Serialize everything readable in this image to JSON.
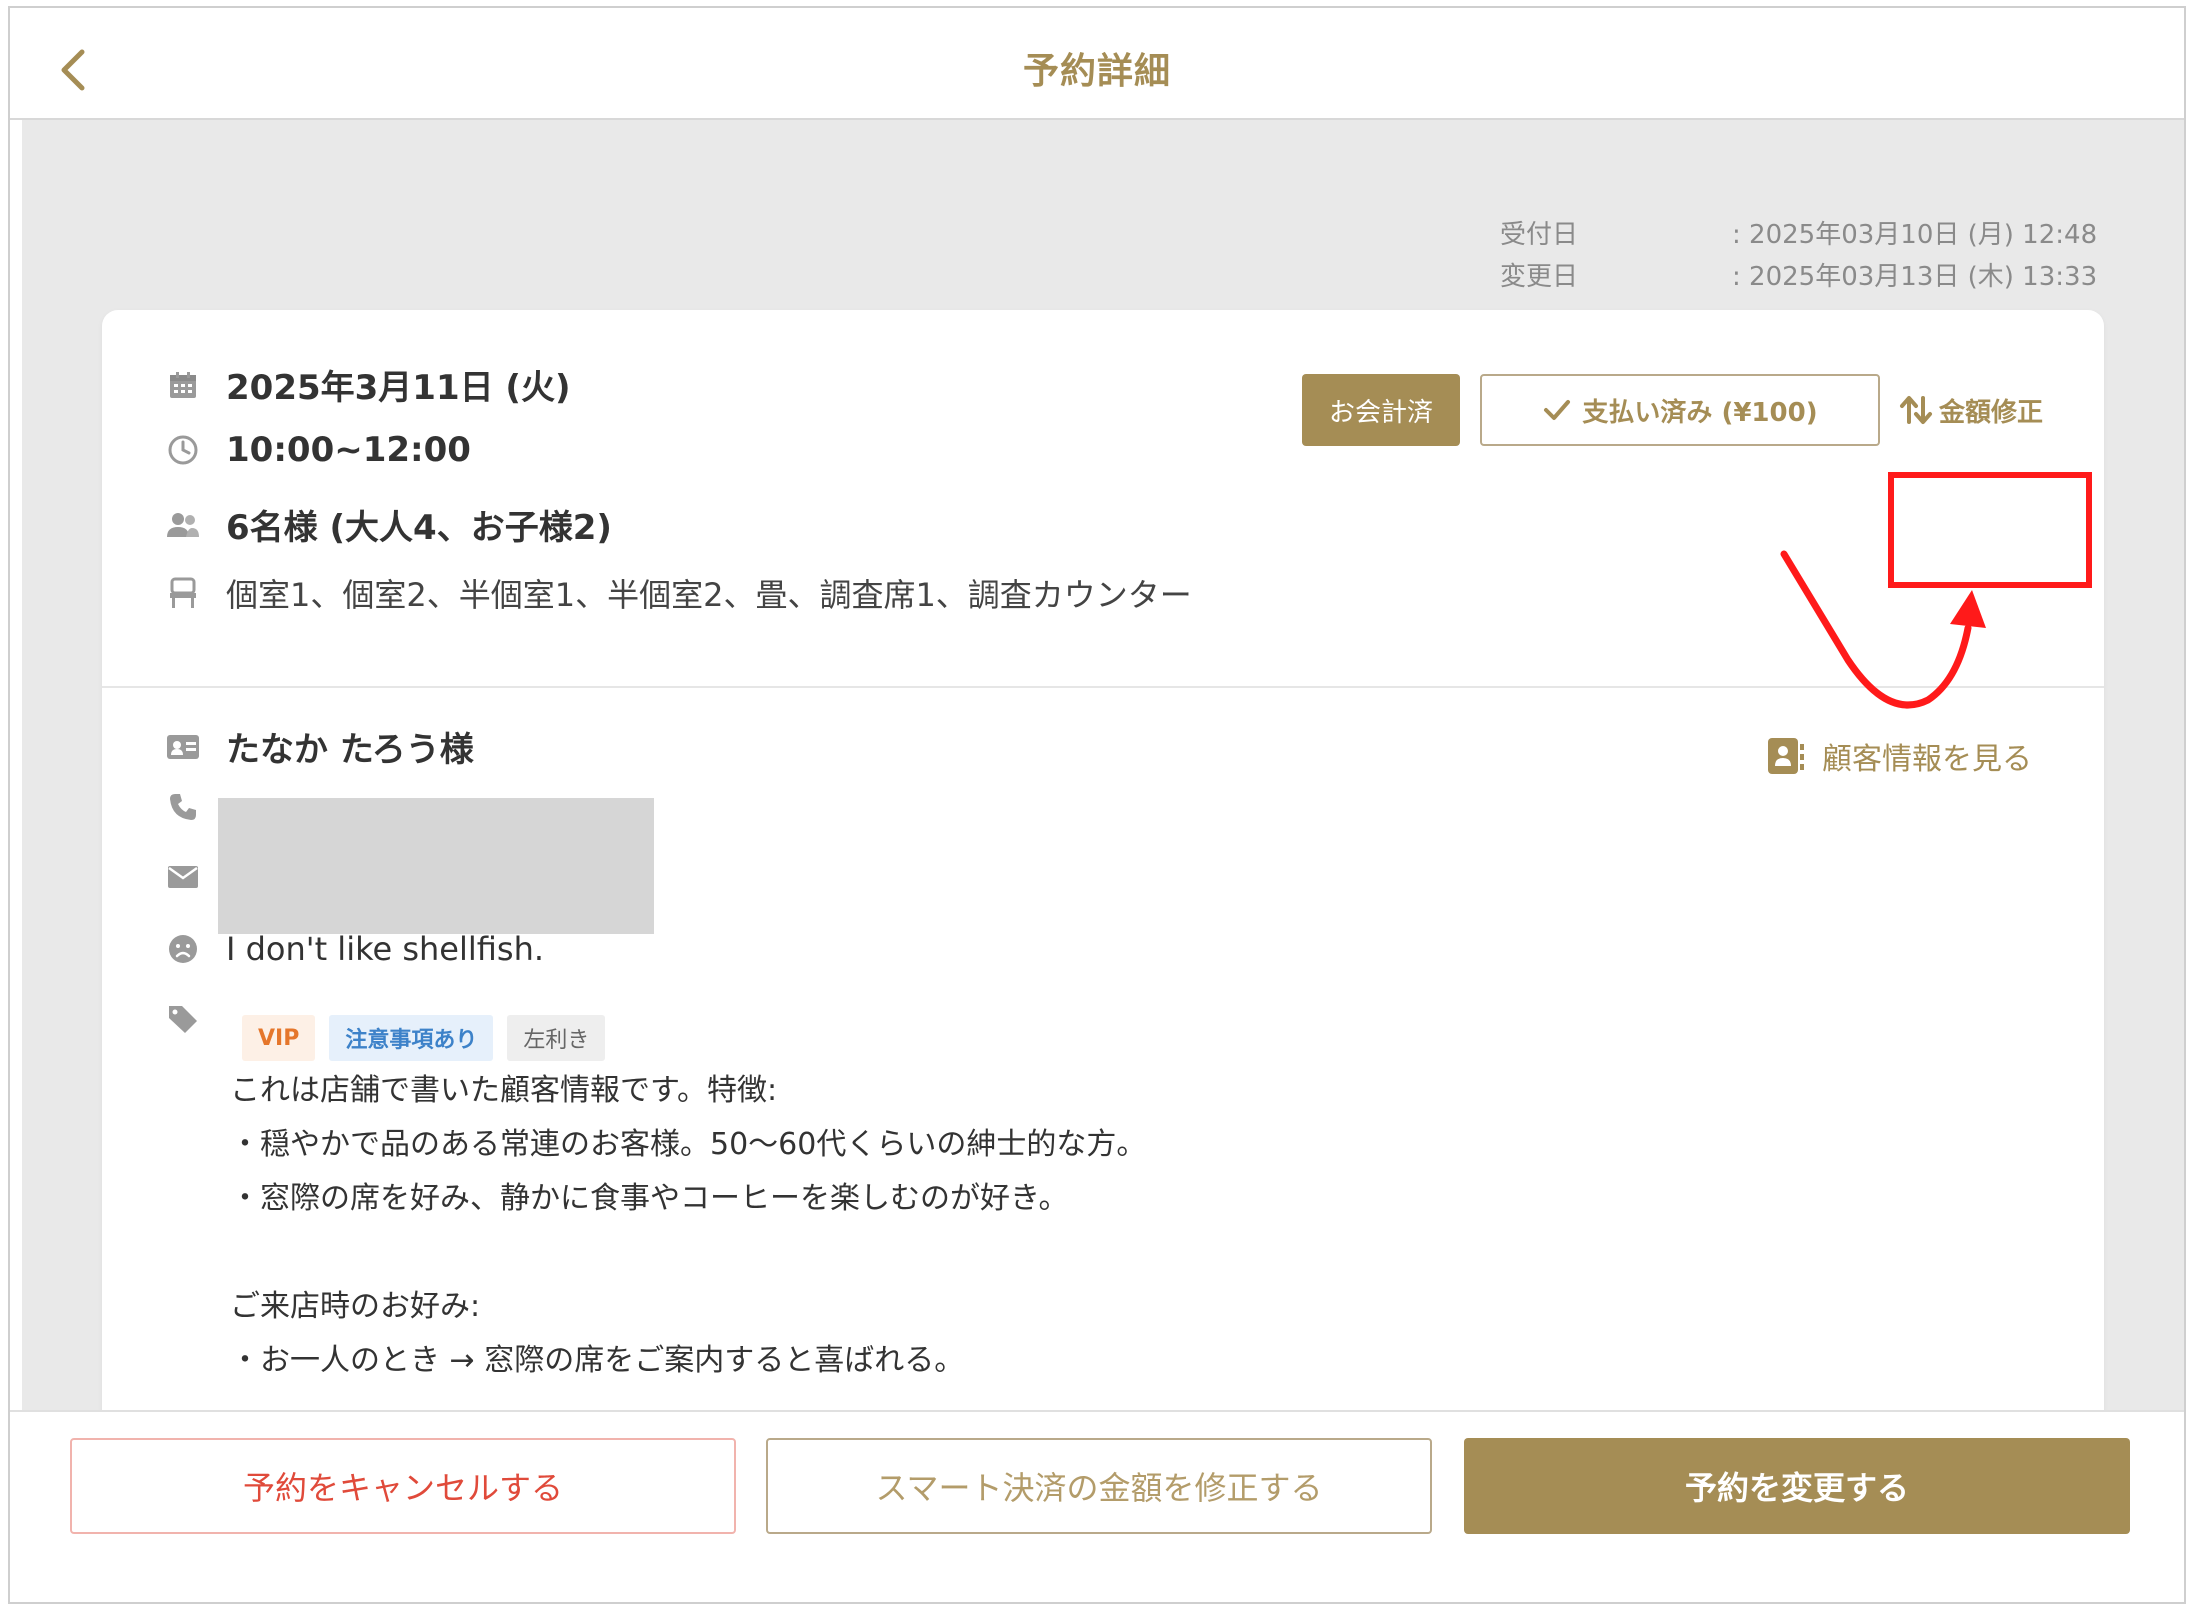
{
  "header": {
    "title": "予約詳細",
    "back_icon": "chevron-left-icon"
  },
  "meta": {
    "received_label": "受付日",
    "received_value": ": 2025年03月10日 (月) 12:48",
    "changed_label": "変更日",
    "changed_value": ": 2025年03月13日 (木) 13:33"
  },
  "reservation": {
    "date": "2025年3月11日 (火)",
    "time": "10:00~12:00",
    "guests": "6名様 (大人4、お子様2)",
    "seats": "個室1、個室2、半個室1、半個室2、畳、調査席1、調査カウンター"
  },
  "actions": {
    "paid_badge": "お会計済",
    "payment_status": "支払い済み (¥100)",
    "adjust_amount": "金額修正"
  },
  "customer": {
    "name": "たなか たろう様",
    "view_info": "顧客情報を見る",
    "allergy": "I don't like shellfish.",
    "tags": [
      "VIP",
      "注意事項あり",
      "左利き"
    ],
    "note": "これは店舗で書いた顧客情報です。特徴:\n・穏やかで品のある常連のお客様。50〜60代くらいの紳士的な方。\n・窓際の席を好み、静かに食事やコーヒーを楽しむのが好き。\n\nご来店時のお好み:\n・お一人のとき → 窓際の席をご案内すると喜ばれる。"
  },
  "footer": {
    "cancel": "予約をキャンセルする",
    "smart_payment": "スマート決済の金額を修正する",
    "change": "予約を変更する"
  },
  "colors": {
    "accent": "#a58d55",
    "danger": "#e04a3a",
    "highlight": "#ff1a1a"
  }
}
